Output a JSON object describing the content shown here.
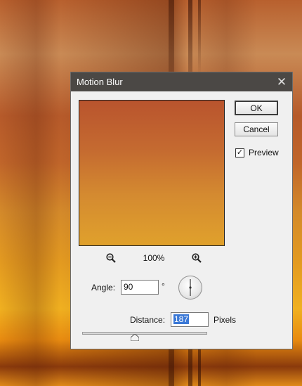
{
  "dialog": {
    "title": "Motion Blur",
    "ok_label": "OK",
    "cancel_label": "Cancel",
    "preview_label": "Preview",
    "preview_checked": true,
    "zoom_level": "100%",
    "angle_label": "Angle:",
    "angle_value": "90",
    "degree_symbol": "°",
    "distance_label": "Distance:",
    "distance_value": "187",
    "distance_unit": "Pixels",
    "distance_slider_fraction": 0.42
  },
  "icons": {
    "close": "close-icon",
    "zoom_out": "zoom-out-icon",
    "zoom_in": "zoom-in-icon"
  },
  "colors": {
    "titlebar": "#4b4845",
    "selection": "#3a78d6"
  }
}
